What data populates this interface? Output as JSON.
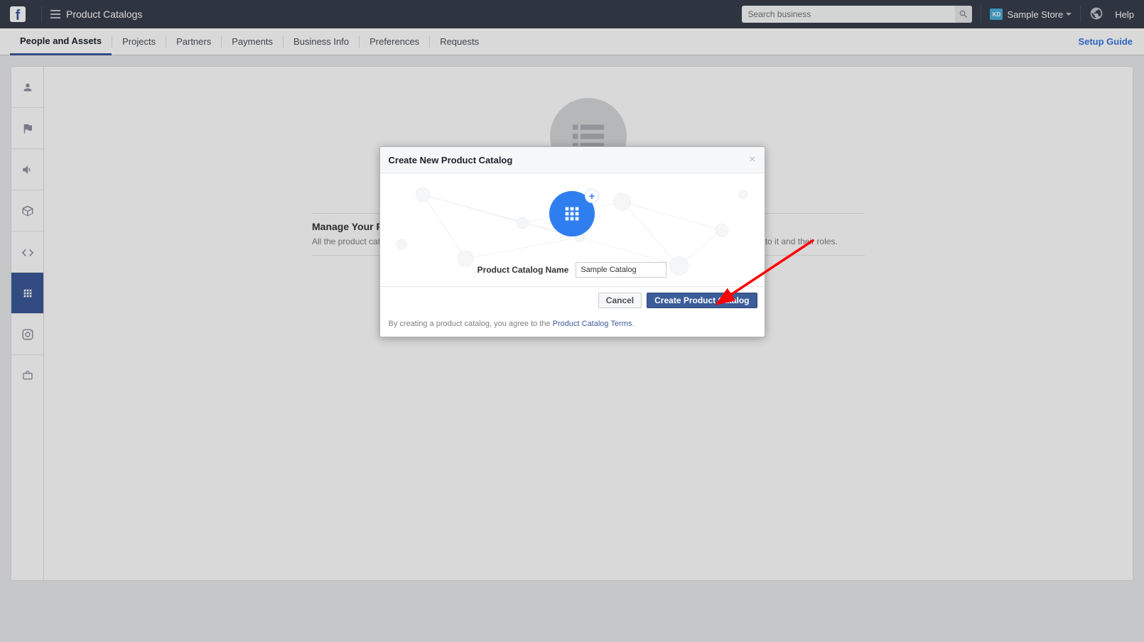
{
  "header": {
    "page_title": "Product Catalogs",
    "search_placeholder": "Search business",
    "store_badge": "KD",
    "store_name": "Sample Store",
    "help": "Help"
  },
  "tabs": {
    "items": [
      {
        "label": "People and Assets",
        "active": true
      },
      {
        "label": "Projects"
      },
      {
        "label": "Partners"
      },
      {
        "label": "Payments"
      },
      {
        "label": "Business Info"
      },
      {
        "label": "Preferences"
      },
      {
        "label": "Requests"
      }
    ],
    "setup_guide": "Setup Guide"
  },
  "content": {
    "heading": "Manage Your Product Catalogs",
    "desc": "All the product catalogs for your business are listed here. Click on a product catalog to see the people who have access to it and their roles."
  },
  "modal": {
    "title": "Create New Product Catalog",
    "name_label": "Product Catalog Name",
    "name_value": "Sample Catalog",
    "cancel": "Cancel",
    "create": "Create Product Catalog",
    "terms_text": "By creating a product catalog, you agree to the ",
    "terms_link": "Product Catalog Terms"
  }
}
